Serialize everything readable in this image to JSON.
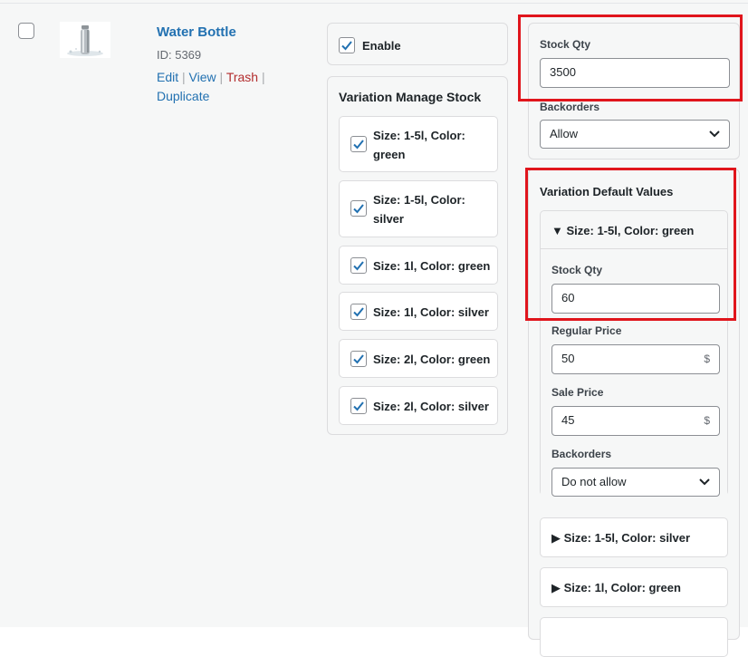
{
  "product": {
    "title": "Water Bottle",
    "id_text": "ID: 5369",
    "actions": {
      "edit": "Edit",
      "view": "View",
      "trash": "Trash",
      "duplicate": "Duplicate",
      "separator": "|"
    }
  },
  "enable": {
    "label": "Enable",
    "checked": true
  },
  "variation_manage_stock": {
    "title": "Variation Manage Stock",
    "items": [
      {
        "line1": "Size: 1-5l, Color:",
        "line2": "green",
        "checked": true
      },
      {
        "line1": "Size: 1-5l, Color:",
        "line2": "silver",
        "checked": true
      },
      {
        "line1": "Size: 1l, Color: green",
        "line2": "",
        "checked": true
      },
      {
        "line1": "Size: 1l, Color: silver",
        "line2": "",
        "checked": true
      },
      {
        "line1": "Size: 2l, Color: green",
        "line2": "",
        "checked": true
      },
      {
        "line1": "Size: 2l, Color: silver",
        "line2": "",
        "checked": true
      }
    ]
  },
  "stock": {
    "qty_label": "Stock Qty",
    "qty_value": "3500",
    "backorders_label": "Backorders",
    "backorders_value": "Allow"
  },
  "defaults": {
    "title": "Variation Default Values",
    "expanded": {
      "header": "Size: 1-5l, Color: green",
      "stock_qty_label": "Stock Qty",
      "stock_qty_value": "60",
      "regular_price_label": "Regular Price",
      "regular_price_value": "50",
      "sale_price_label": "Sale Price",
      "sale_price_value": "45",
      "currency": "$",
      "backorders_label": "Backorders",
      "backorders_value": "Do not allow"
    },
    "collapsed": [
      {
        "header": "Size: 1-5l, Color: silver"
      },
      {
        "header": "Size: 1l, Color: green"
      }
    ]
  },
  "icons": {
    "expanded_marker": "▼",
    "collapsed_marker": "▶",
    "checkmark": "check-icon",
    "chevron": "chevron-down-icon"
  },
  "colors": {
    "link": "#2271b1",
    "trash": "#b32d2e",
    "highlight": "#e0151c",
    "checkbox_check": "#2271b1"
  }
}
